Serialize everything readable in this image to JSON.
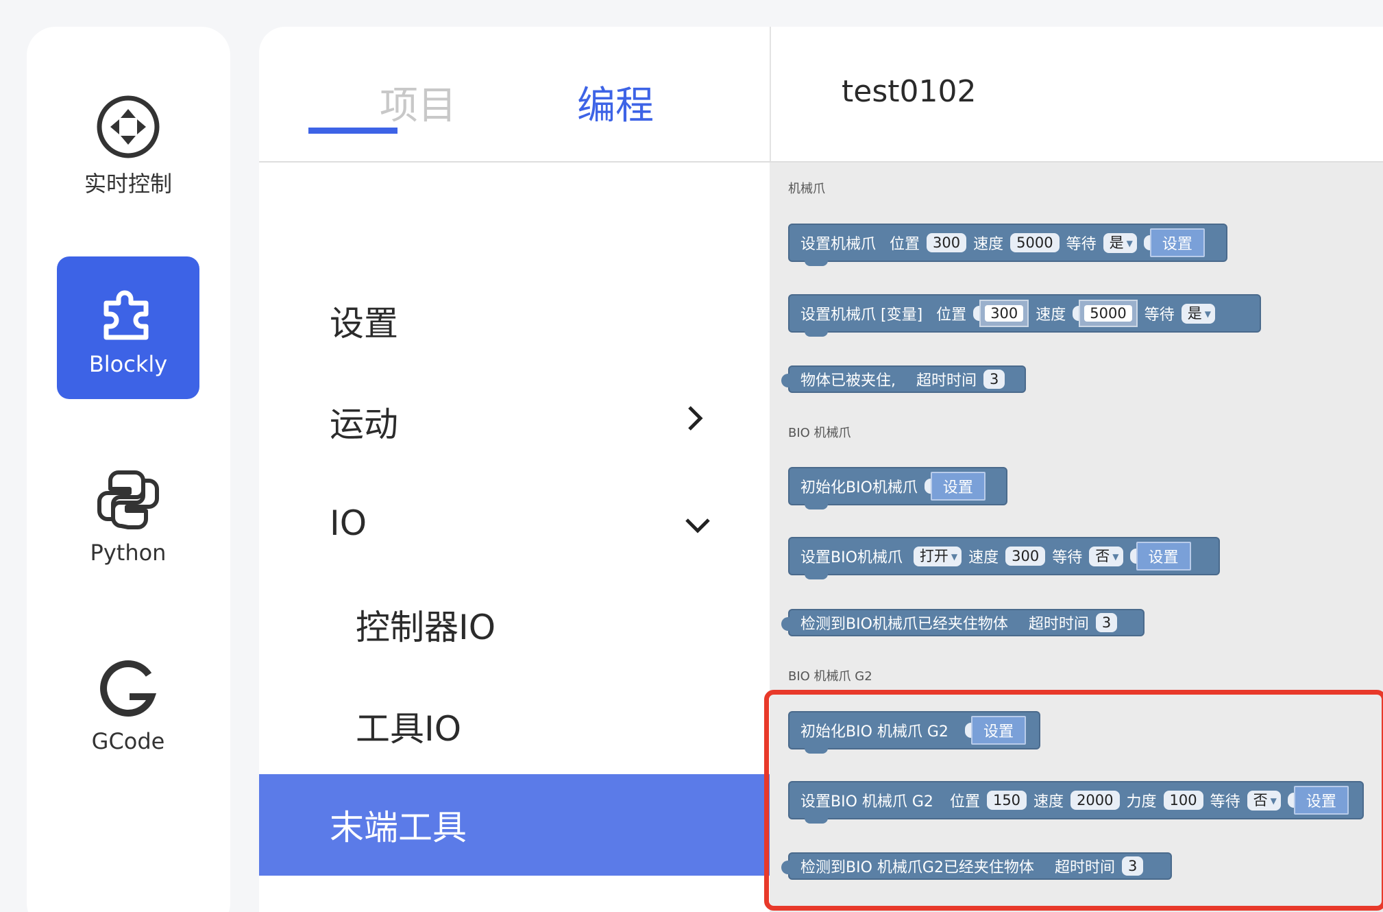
{
  "sidebar": {
    "items": [
      {
        "label": "实时控制",
        "icon": "joystick-icon"
      },
      {
        "label": "Blockly",
        "icon": "puzzle-icon",
        "active": true
      },
      {
        "label": "Python",
        "icon": "python-icon"
      },
      {
        "label": "GCode",
        "icon": "gcode-icon"
      }
    ]
  },
  "header": {
    "tabs": [
      {
        "label": "项目",
        "active": false
      },
      {
        "label": "编程",
        "active": true
      }
    ],
    "project_name": "test0102"
  },
  "menu": {
    "items": [
      {
        "label": "设置"
      },
      {
        "label": "运动",
        "chevron": "chevron-right-icon"
      },
      {
        "label": "IO",
        "chevron": "chevron-down-icon"
      },
      {
        "label": "控制器IO",
        "sub": true
      },
      {
        "label": "工具IO",
        "sub": true
      },
      {
        "label": "末端工具",
        "active": true
      }
    ]
  },
  "flyout": {
    "sections": [
      {
        "title": "机械爪"
      },
      {
        "title": "BIO 机械爪"
      },
      {
        "title": "BIO 机械爪 G2"
      }
    ],
    "gripper": {
      "b1": {
        "label": "设置机械爪",
        "pos_label": "位置",
        "pos": "300",
        "speed_label": "速度",
        "speed": "5000",
        "wait_label": "等待",
        "wait": "是",
        "btn": "设置"
      },
      "b2": {
        "label": "设置机械爪 [变量]",
        "pos_label": "位置",
        "pos": "300",
        "speed_label": "速度",
        "speed": "5000",
        "wait_label": "等待",
        "wait": "是"
      },
      "b3": {
        "label": "物体已被夹住,",
        "timeout_label": "超时时间",
        "timeout": "3"
      }
    },
    "bio": {
      "b1": {
        "label": "初始化BIO机械爪",
        "btn": "设置"
      },
      "b2": {
        "label": "设置BIO机械爪",
        "mode": "打开",
        "speed_label": "速度",
        "speed": "300",
        "wait_label": "等待",
        "wait": "否",
        "btn": "设置"
      },
      "b3": {
        "label": "检测到BIO机械爪已经夹住物体",
        "timeout_label": "超时时间",
        "timeout": "3"
      }
    },
    "g2": {
      "b1": {
        "label": "初始化BIO 机械爪 G2",
        "btn": "设置"
      },
      "b2": {
        "label": "设置BIO 机械爪 G2",
        "pos_label": "位置",
        "pos": "150",
        "speed_label": "速度",
        "speed": "2000",
        "force_label": "力度",
        "force": "100",
        "wait_label": "等待",
        "wait": "否",
        "btn": "设置"
      },
      "b3": {
        "label": "检测到BIO 机械爪G2已经夹住物体",
        "timeout_label": "超时时间",
        "timeout": "3"
      }
    }
  },
  "colors": {
    "accent": "#3d63e6",
    "menu_active": "#5b7be8",
    "block": "#5b80a5",
    "highlight": "#e8392a"
  }
}
